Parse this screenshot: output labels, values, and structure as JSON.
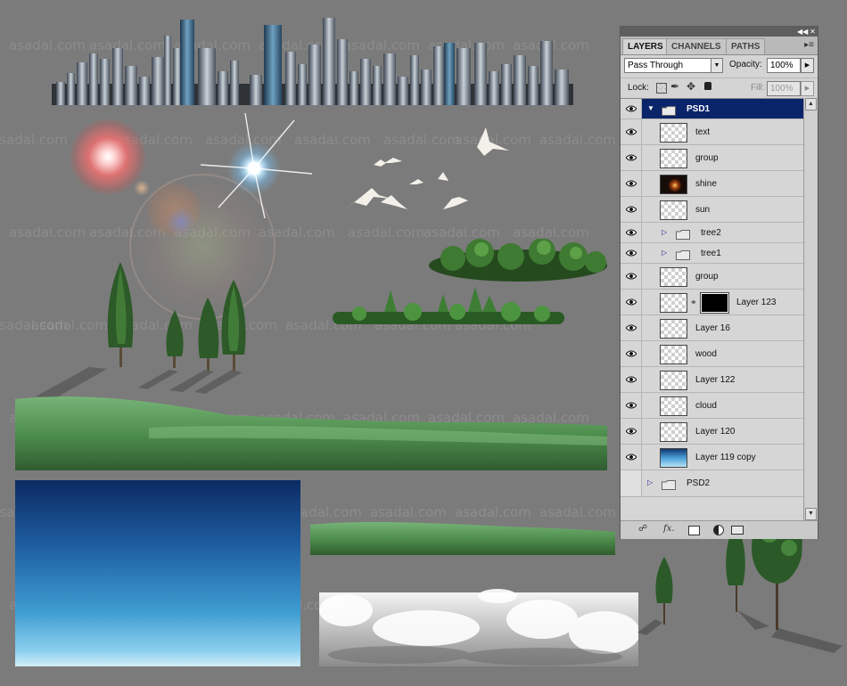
{
  "watermark": "asadal.com",
  "panel": {
    "tabs": [
      "LAYERS",
      "CHANNELS",
      "PATHS"
    ],
    "active_tab": "LAYERS",
    "blend_mode": "Pass Through",
    "opacity_label": "Opacity:",
    "opacity_value": "100%",
    "lock_label": "Lock:",
    "fill_label": "Fill:",
    "fill_value": "100%",
    "layers": [
      {
        "name": "PSD1",
        "kind": "group-open",
        "selected": true
      },
      {
        "name": "text",
        "kind": "layer"
      },
      {
        "name": "group",
        "kind": "layer"
      },
      {
        "name": "shine",
        "kind": "layer-shine"
      },
      {
        "name": "sun",
        "kind": "layer"
      },
      {
        "name": "tree2",
        "kind": "group-closed"
      },
      {
        "name": "tree1",
        "kind": "group-closed"
      },
      {
        "name": "group",
        "kind": "layer"
      },
      {
        "name": "Layer 123",
        "kind": "layer-mask"
      },
      {
        "name": "Layer 16",
        "kind": "layer"
      },
      {
        "name": "wood",
        "kind": "layer"
      },
      {
        "name": "Layer 122",
        "kind": "layer"
      },
      {
        "name": "cloud",
        "kind": "layer"
      },
      {
        "name": "Layer 120",
        "kind": "layer"
      },
      {
        "name": "Layer 119 copy",
        "kind": "layer-sky"
      },
      {
        "name": "PSD2",
        "kind": "group-top-closed",
        "hidden": true
      }
    ],
    "bottom_icons": [
      "link-icon",
      "fx-icon",
      "mask-icon",
      "adjustment-icon",
      "new-group-icon"
    ]
  },
  "colors": {
    "canvas_bg": "#7b7b7b",
    "selection": "#0a246a",
    "panel_bg": "#d4d4d4"
  }
}
